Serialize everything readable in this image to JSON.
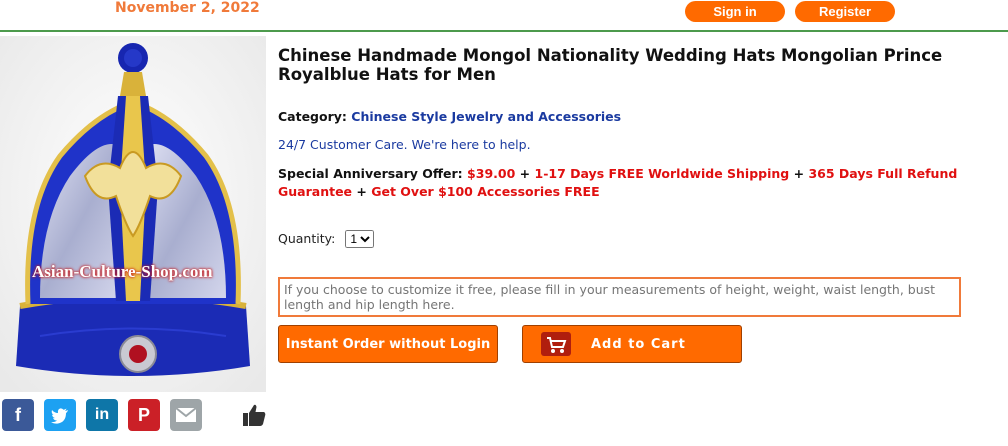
{
  "header": {
    "date": "November 2, 2022",
    "signin_label": "Sign in",
    "register_label": "Register"
  },
  "product": {
    "title": "Chinese Handmade Mongol Nationality Wedding Hats Mongolian Prince Royalblue Hats for Men",
    "category_label": "Category:",
    "category_value": "Chinese Style Jewelry and Accessories",
    "care_text": "24/7 Customer Care. We're here to help.",
    "offer": {
      "label": "Special Anniversary Offer:",
      "price": "$39.00",
      "plus": "+",
      "shipping": "1-17 Days FREE Worldwide Shipping",
      "refund": "365 Days Full Refund Guarantee",
      "accessories": "Get Over $100 Accessories FREE"
    },
    "quantity_label": "Quantity:",
    "quantity_value": "1",
    "custom_placeholder": "If you choose to customize it free, please fill in your measurements of height, weight, waist length, bust length and hip length here.",
    "image_watermark": "Asian-Culture-Shop.com"
  },
  "actions": {
    "instant_order_label": "Instant Order without Login",
    "add_to_cart_label": "Add to Cart"
  },
  "social": {
    "icons": [
      "facebook-icon",
      "twitter-icon",
      "linkedin-icon",
      "pinterest-icon",
      "email-icon",
      "thumbs-up-icon"
    ]
  },
  "colors": {
    "accent_orange": "#ff6a00",
    "date_orange": "#f07a3a",
    "link_blue": "#1a3aa0",
    "offer_red": "#e01010",
    "hat_blue": "#1b2fbf"
  }
}
